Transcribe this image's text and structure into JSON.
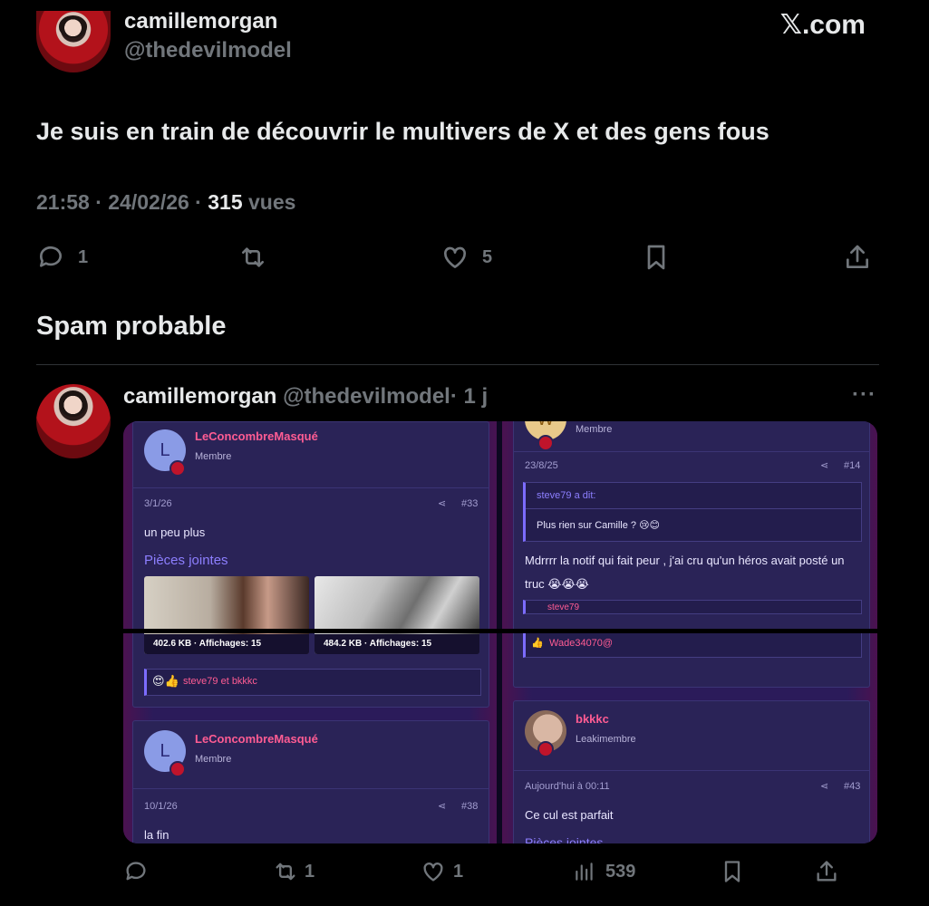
{
  "tweet": {
    "author_name": "camillemorgan",
    "author_handle": "@thedevilmodel",
    "brand": "𝕏.com",
    "text": "Je suis en train de découvrir le multivers de X et des gens fous",
    "time": "21:58 · 24/02/26 · ",
    "views_count": "315",
    "views_label": " vues",
    "actions": {
      "reply_count": "1",
      "like_count": "5"
    }
  },
  "section_title": "Spam probable",
  "reply": {
    "author_name": "camillemorgan",
    "author_handle": "@thedevilmodel",
    "age": "· 1 j",
    "more": "···",
    "actions": {
      "retweet_count": "1",
      "like_count": "1",
      "views_count": "539"
    }
  },
  "forum": {
    "left_post1": {
      "user": "LeConcombreMasqué",
      "role": "Membre",
      "avatar_letter": "L",
      "date": "3/1/26",
      "post_no": "#33",
      "text": "un peu plus",
      "attachments_title": "Pièces jointes",
      "attachments": [
        {
          "size": "402.6 KB · Affichages: 15"
        },
        {
          "size": "484.2 KB · Affichages: 15"
        }
      ],
      "reactions": "steve79 et bkkkc"
    },
    "left_post2": {
      "user": "LeConcombreMasqué",
      "role": "Membre",
      "avatar_letter": "L",
      "date": "10/1/26",
      "post_no": "#38",
      "text": "la fin"
    },
    "right_post1": {
      "role": "Membre",
      "avatar_letter": "W",
      "date": "23/8/25",
      "post_no": "#14",
      "quote_author": "steve79 a dit:",
      "quote_text": "Plus rien sur Camille ? 😢😊",
      "text": "Mdrrrr la notif qui fait peur , j'ai cru qu'un héros avait posté un truc 😭😭😭",
      "partial_quote": "steve79",
      "reactions": "Wade34070@"
    },
    "right_post2": {
      "user": "bkkkc",
      "role": "Leakimembre",
      "date": "Aujourd'hui à 00:11",
      "post_no": "#43",
      "text": "Ce cul est parfait",
      "attachments_title": "Pièces jointes"
    }
  }
}
